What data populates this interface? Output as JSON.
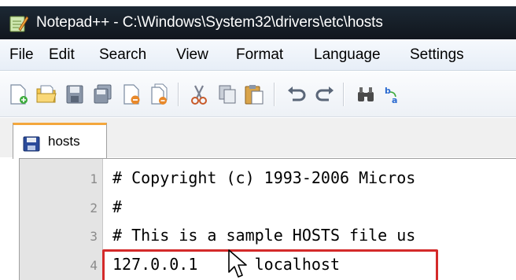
{
  "window": {
    "title": "Notepad++ - C:\\Windows\\System32\\drivers\\etc\\hosts",
    "app_icon": "notepadpp-icon"
  },
  "menu": {
    "items": [
      "File",
      "Edit",
      "Search",
      "View",
      "Format",
      "Language",
      "Settings"
    ]
  },
  "toolbar": {
    "buttons": [
      "new-file-icon",
      "open-file-icon",
      "save-icon",
      "save-all-icon",
      "close-icon",
      "close-all-icon",
      "cut-icon",
      "copy-icon",
      "paste-icon",
      "undo-icon",
      "redo-icon",
      "find-icon",
      "replace-icon"
    ]
  },
  "tabs": [
    {
      "label": "hosts",
      "icon": "file-saved-icon",
      "active": true
    }
  ],
  "editor": {
    "lines": [
      {
        "number": "1",
        "text": "# Copyright (c) 1993-2006 Micros"
      },
      {
        "number": "2",
        "text": "#"
      },
      {
        "number": "3",
        "text": "# This is a sample HOSTS file us"
      },
      {
        "number": "4",
        "text": "127.0.0.1      localhost"
      }
    ],
    "highlighted_line": "4",
    "highlight_color": "#d42a2a"
  },
  "colors": {
    "title_bar": "#1c2834",
    "tab_accent": "#f4a73c",
    "gutter": "#e4e4e4"
  }
}
